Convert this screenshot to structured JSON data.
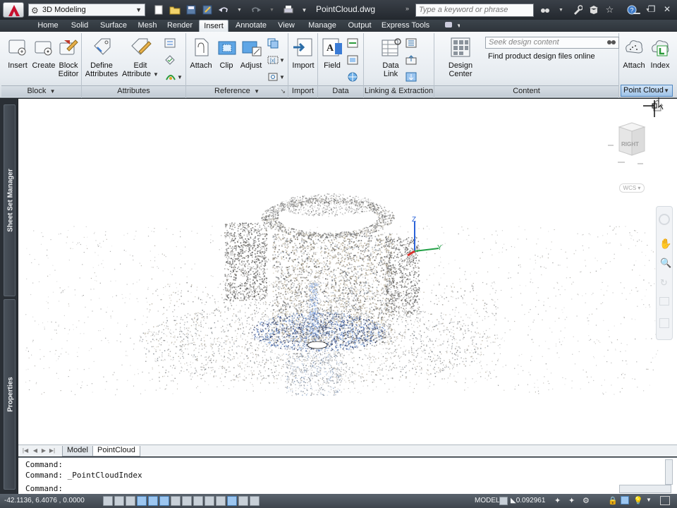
{
  "titlebar": {
    "workspace": "3D Modeling",
    "document": "PointCloud.dwg",
    "search_placeholder": "Type a keyword or phrase"
  },
  "tabs": [
    {
      "label": "Home"
    },
    {
      "label": "Solid"
    },
    {
      "label": "Surface"
    },
    {
      "label": "Mesh"
    },
    {
      "label": "Render"
    },
    {
      "label": "Insert"
    },
    {
      "label": "Annotate"
    },
    {
      "label": "View"
    },
    {
      "label": "Manage"
    },
    {
      "label": "Output"
    },
    {
      "label": "Express Tools"
    }
  ],
  "active_tab": "Insert",
  "ribbon": {
    "block": {
      "title": "Block",
      "insert": "Insert",
      "create": "Create",
      "block_editor_1": "Block",
      "block_editor_2": "Editor"
    },
    "attributes": {
      "title": "Attributes",
      "define_1": "Define",
      "define_2": "Attributes",
      "edit_1": "Edit",
      "edit_2": "Attribute"
    },
    "reference": {
      "title": "Reference",
      "attach": "Attach",
      "clip": "Clip",
      "adjust": "Adjust"
    },
    "import": {
      "title": "Import",
      "import": "Import"
    },
    "data": {
      "title": "Data",
      "field": "Field"
    },
    "linking": {
      "title": "Linking & Extraction",
      "data_link_1": "Data",
      "data_link_2": "Link"
    },
    "content": {
      "title": "Content",
      "design_center": "Design Center",
      "seek_placeholder": "Seek design content",
      "seek_desc": "Find product design files online"
    },
    "point_cloud": {
      "title": "Point Cloud",
      "attach": "Attach",
      "index": "Index"
    }
  },
  "side_palettes": {
    "sheet_set": "Sheet Set Manager",
    "properties": "Properties"
  },
  "viewcube": {
    "face": "RIGHT",
    "ucs": "WCS"
  },
  "axes": {
    "x": "X",
    "y": "Y",
    "z": "Z"
  },
  "layout_tabs": [
    {
      "label": "Model"
    },
    {
      "label": "PointCloud"
    }
  ],
  "command_lines": [
    "Command:",
    "Command:  _PointCloudIndex",
    "Command:"
  ],
  "status": {
    "coords": "-42.1136, 6.4076 , 0.0000",
    "model": "MODEL",
    "scale": "0.092961"
  }
}
